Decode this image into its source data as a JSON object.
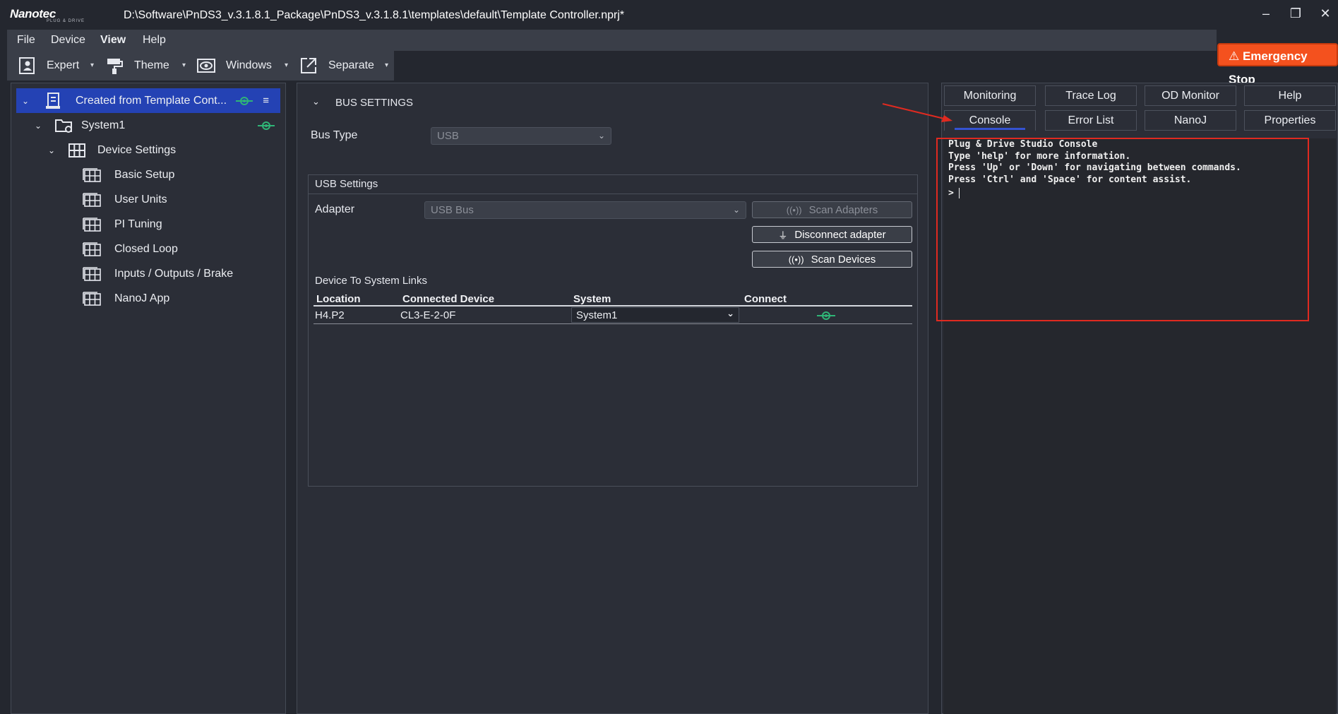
{
  "app": {
    "logo_text": "Nanotec",
    "logo_tagline": "PLUG & DRIVE",
    "window_title": "D:\\Software\\PnDS3_v.3.1.8.1_Package\\PnDS3_v.3.1.8.1\\templates\\default\\Template Controller.nprj*"
  },
  "window_controls": {
    "minimize": "–",
    "maximize": "❐",
    "close": "✕"
  },
  "menu": [
    "File",
    "Device",
    "View",
    "Help"
  ],
  "toolbar": {
    "expert": "Expert",
    "theme": "Theme",
    "windows": "Windows",
    "separate": "Separate",
    "dropdown_glyph": "▾"
  },
  "emergency_stop": "⚠ Emergency Stop",
  "tree": {
    "root": "Created from Template Cont...",
    "system": "System1",
    "device_settings": "Device Settings",
    "items": [
      "Basic Setup",
      "User Units",
      "PI Tuning",
      "Closed Loop",
      "Inputs / Outputs / Brake",
      "NanoJ App"
    ]
  },
  "bus_settings": {
    "header": "BUS SETTINGS",
    "bus_type_label": "Bus Type",
    "bus_type_value": "USB",
    "usb_group_title": "USB Settings",
    "adapter_label": "Adapter",
    "adapter_value": "USB Bus",
    "scan_adapters": "Scan Adapters",
    "disconnect_adapter": "Disconnect adapter",
    "scan_devices": "Scan Devices",
    "links_title": "Device To System Links",
    "table": {
      "headers": [
        "Location",
        "Connected Device",
        "System",
        "Connect"
      ],
      "rows": [
        {
          "location": "H4.P2",
          "device": "CL3-E-2-0F",
          "system": "System1"
        }
      ]
    }
  },
  "right_tabs": {
    "row1": [
      "Monitoring",
      "Trace Log",
      "OD Monitor",
      "Help"
    ],
    "row2": [
      "Console",
      "Error List",
      "NanoJ",
      "Properties"
    ],
    "active": "Console"
  },
  "console": {
    "lines": [
      "Plug & Drive Studio Console",
      "Type 'help' for more information.",
      "Press 'Up' or 'Down' for navigating between commands.",
      "Press 'Ctrl' and 'Space' for content assist."
    ],
    "prompt": ">"
  },
  "colors": {
    "background": "#24272f",
    "panel": "#2b2e37",
    "selection": "#2442b4",
    "accent_connect": "#2fb577",
    "emergency": "#f4511e",
    "annotation_red": "#e02a20"
  },
  "icons": {
    "expert": "expert-icon",
    "theme": "paint-roller-icon",
    "windows": "eye-icon",
    "separate": "external-link-icon",
    "connect": "connect-plug-icon",
    "menu": "hamburger-icon"
  }
}
